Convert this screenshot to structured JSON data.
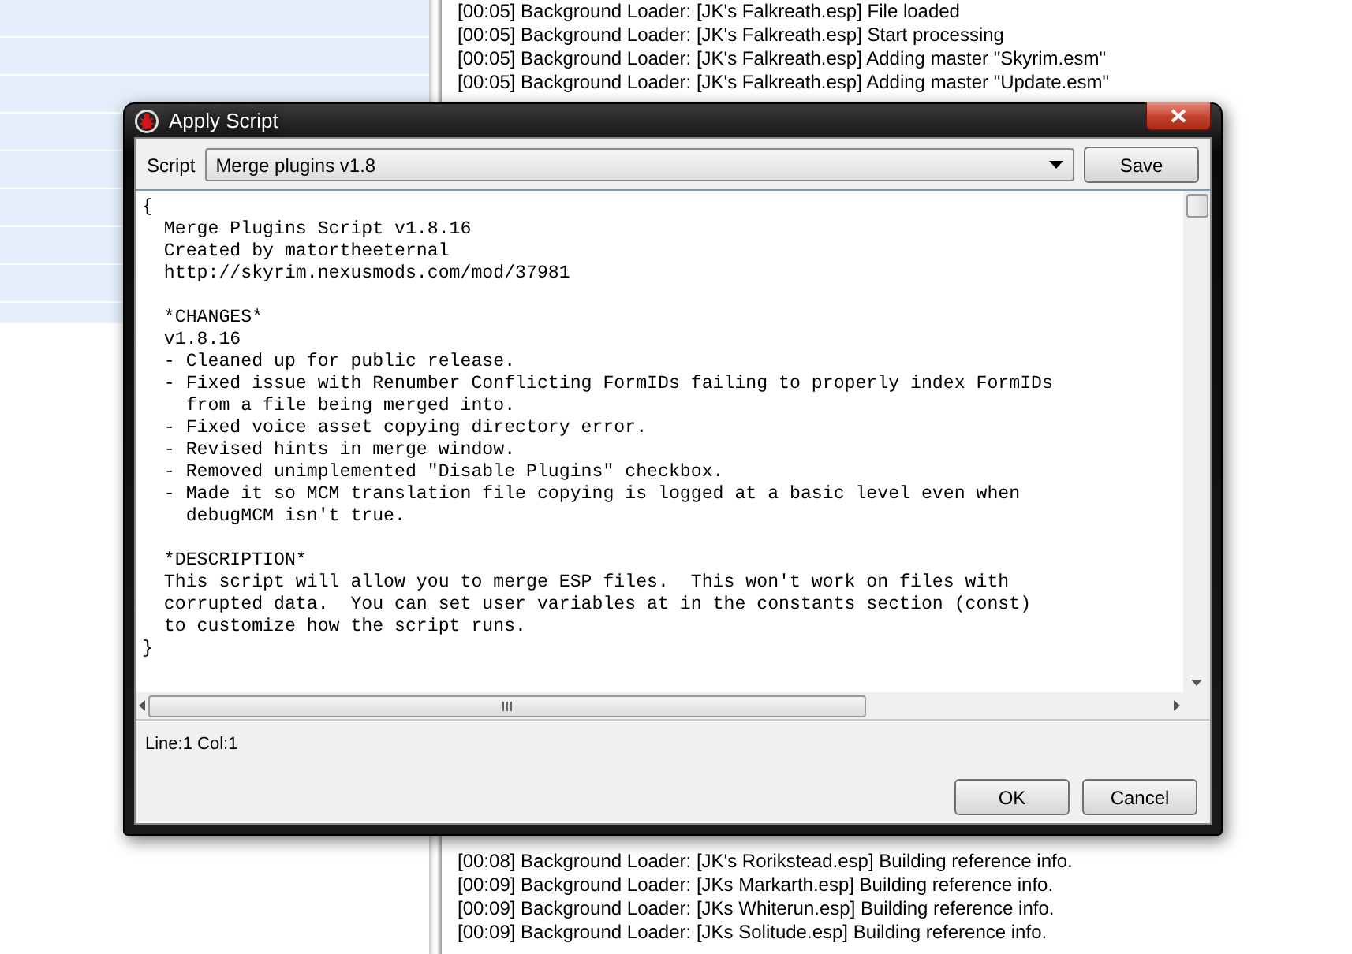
{
  "log_top": [
    "[00:05] Background Loader: [JK's Falkreath.esp] File loaded",
    "[00:05] Background Loader: [JK's Falkreath.esp] Start processing",
    "[00:05] Background Loader: [JK's Falkreath.esp] Adding master \"Skyrim.esm\"",
    "[00:05] Background Loader: [JK's Falkreath.esp] Adding master \"Update.esm\""
  ],
  "log_bottom": [
    "[00:08] Background Loader: [JK's Rorikstead.esp] Building reference info.",
    "[00:09] Background Loader: [JKs Markarth.esp] Building reference info.",
    "[00:09] Background Loader: [JKs Whiterun.esp] Building reference info.",
    "[00:09] Background Loader: [JKs Solitude.esp] Building reference info."
  ],
  "dialog": {
    "title": "Apply Script",
    "script_label": "Script",
    "script_value": "Merge plugins v1.8",
    "save_button": "Save",
    "editor_text": "{\n  Merge Plugins Script v1.8.16\n  Created by matortheeternal\n  http://skyrim.nexusmods.com/mod/37981\n\n  *CHANGES*\n  v1.8.16\n  - Cleaned up for public release.\n  - Fixed issue with Renumber Conflicting FormIDs failing to properly index FormIDs\n    from a file being merged into.\n  - Fixed voice asset copying directory error.\n  - Revised hints in merge window.\n  - Removed unimplemented \"Disable Plugins\" checkbox.\n  - Made it so MCM translation file copying is logged at a basic level even when\n    debugMCM isn't true.\n\n  *DESCRIPTION*\n  This script will allow you to merge ESP files.  This won't work on files with\n  corrupted data.  You can set user variables at in the constants section (const)\n  to customize how the script runs.\n}",
    "status": "Line:1 Col:1",
    "buttons": [
      "OK",
      "Cancel"
    ]
  }
}
